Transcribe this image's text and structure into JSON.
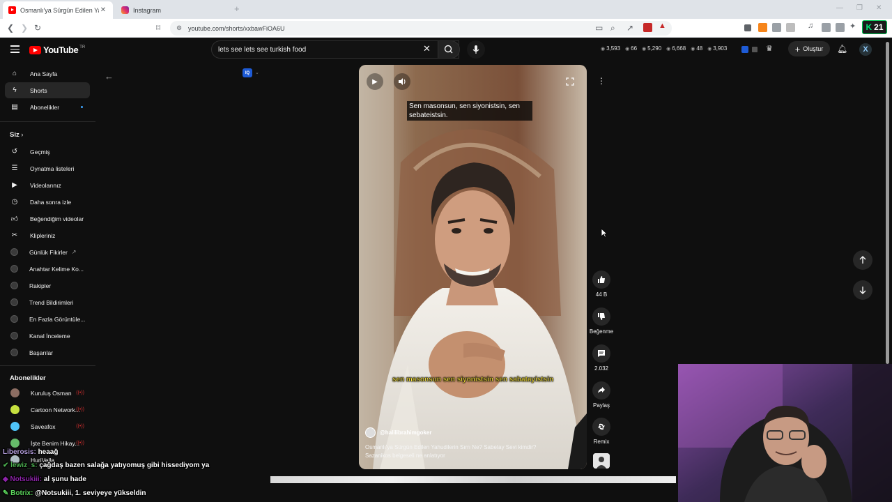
{
  "browser": {
    "tabs": [
      {
        "title": "Osmanlı'ya Sürgün Edilen Yahudi...",
        "active": true
      },
      {
        "title": "Instagram",
        "active": false
      }
    ],
    "url": "youtube.com/shorts/xxbawFiOA6U",
    "counter_badge": "21"
  },
  "masthead": {
    "logo_text": "YouTube",
    "region": "TR",
    "search_value": "lets see lets see turkish food",
    "stats": [
      "3,593",
      "66",
      "5,290",
      "6,668",
      "48",
      "3,903"
    ],
    "create_label": "Oluştur"
  },
  "sidebar": {
    "main": [
      {
        "label": "Ana Sayfa",
        "icon": "home-icon"
      },
      {
        "label": "Shorts",
        "icon": "shorts-icon",
        "active": true
      },
      {
        "label": "Abonelikler",
        "icon": "subscriptions-icon"
      }
    ],
    "you_header": "Siz",
    "you": [
      {
        "label": "Geçmiş",
        "icon": "history-icon"
      },
      {
        "label": "Oynatma listeleri",
        "icon": "playlist-icon"
      },
      {
        "label": "Videolarınız",
        "icon": "your-videos-icon"
      },
      {
        "label": "Daha sonra izle",
        "icon": "watch-later-icon"
      },
      {
        "label": "Beğendiğim videolar",
        "icon": "liked-icon"
      },
      {
        "label": "Klipleriniz",
        "icon": "clips-icon"
      }
    ],
    "tools": [
      {
        "label": "Günlük Fikirler"
      },
      {
        "label": "Anahtar Kelime Ko..."
      },
      {
        "label": "Rakipler"
      },
      {
        "label": "Trend Bildirimleri"
      },
      {
        "label": "En Fazla Görüntüle..."
      },
      {
        "label": "Kanal İnceleme"
      },
      {
        "label": "Başarılar"
      }
    ],
    "subs_header": "Abonelikler",
    "subs": [
      {
        "label": "Kuruluş Osman",
        "color": "#8d6e63"
      },
      {
        "label": "Cartoon Network...",
        "color": "#c6e03f"
      },
      {
        "label": "Saveafox",
        "color": "#4fc3f7"
      },
      {
        "label": "İşte Benim Hikay...",
        "color": "#66bb6a"
      },
      {
        "label": "HuriVella",
        "color": "#b0bec5"
      }
    ]
  },
  "short": {
    "subtitle_top": "Sen masonsun, sen siyonistsin, sen sebateistsin.",
    "subtitle_burned": "sen masonsun sen siyonistsin sen sabatayistsin",
    "channel": "@halilibrahimgoker",
    "title": "Osmanlı'ya Sürgün Edilen Yahudilerin Sırrı Ne? Sabetay Sevi kimdir? Sazanikos belgeseli ne anlatıyor"
  },
  "actions": {
    "likes": "44 B",
    "dislike_label": "Beğenme",
    "comments": "2.032",
    "share_label": "Paylaş",
    "remix_label": "Remix"
  },
  "chat": [
    {
      "user": "Liberosis:",
      "text": "heaağ",
      "color": "#b39ddb"
    },
    {
      "user": "lewiz_s:",
      "text": "çağdaş bazen salağa yatıyomuş gibi hissediyom ya",
      "color": "#4caf50"
    },
    {
      "user": "Notsukiii:",
      "text": "al şunu hade",
      "color": "#8e24aa"
    },
    {
      "user": "Botrix:",
      "text": "@Notsukiii, 1. seviyeye yükseldin",
      "color": "#5dd85d"
    }
  ]
}
